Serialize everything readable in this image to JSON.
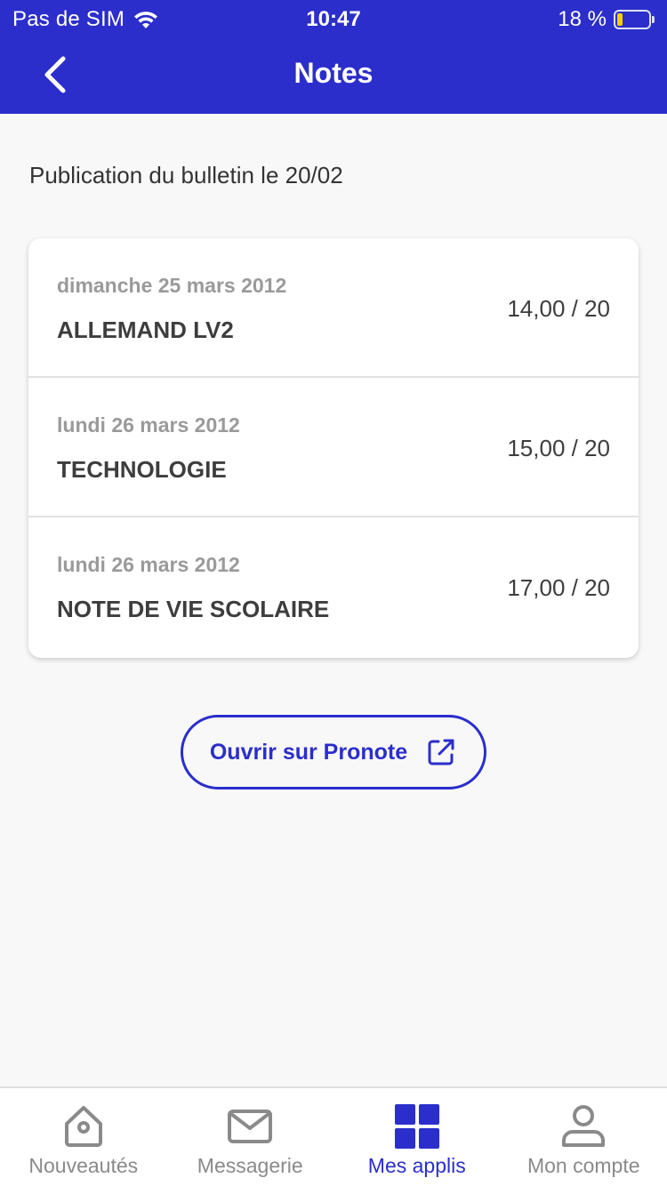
{
  "status_bar": {
    "carrier": "Pas de SIM",
    "time": "10:47",
    "battery": "18 %",
    "battery_level": 0.18
  },
  "header": {
    "title": "Notes"
  },
  "publication": "Publication du bulletin le 20/02",
  "grades": [
    {
      "date": "dimanche 25 mars 2012",
      "subject": "ALLEMAND LV2",
      "value": "14,00 / 20"
    },
    {
      "date": "lundi 26 mars 2012",
      "subject": "TECHNOLOGIE",
      "value": "15,00 / 20"
    },
    {
      "date": "lundi 26 mars 2012",
      "subject": "NOTE DE VIE SCOLAIRE",
      "value": "17,00 / 20"
    }
  ],
  "open_button": {
    "label": "Ouvrir sur Pronote",
    "icon": "external-link-icon"
  },
  "bottom_nav": [
    {
      "label": "Nouveautés",
      "icon": "home-icon",
      "active": false
    },
    {
      "label": "Messagerie",
      "icon": "mail-icon",
      "active": false
    },
    {
      "label": "Mes applis",
      "icon": "apps-grid-icon",
      "active": true
    },
    {
      "label": "Mon compte",
      "icon": "account-icon",
      "active": false
    }
  ],
  "colors": {
    "primary": "#2b2ecb",
    "inactive": "#8a8a8a",
    "background": "#f8f8f8"
  }
}
